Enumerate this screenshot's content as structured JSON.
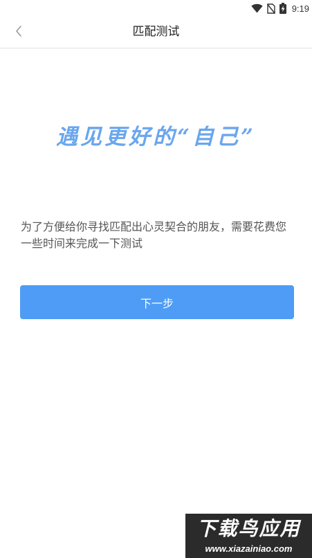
{
  "status_bar": {
    "time": "9:19",
    "icons": [
      "wifi-icon",
      "no-sim-icon",
      "battery-charging-icon"
    ]
  },
  "header": {
    "title": "匹配测试",
    "back_icon": "chevron-left-icon"
  },
  "main": {
    "headline": "遇见更好的“自己”",
    "description": "为了方便给你寻找匹配出心灵契合的朋友，需要花费您一些时间来完成一下测试",
    "next_button_label": "下一步"
  },
  "watermark": {
    "title": "下载鸟应用",
    "url": "www.xiazainiao.com"
  },
  "colors": {
    "accent": "#4e9cf5",
    "headline": "#6aa6ee",
    "text": "#555555",
    "title": "#222222"
  }
}
